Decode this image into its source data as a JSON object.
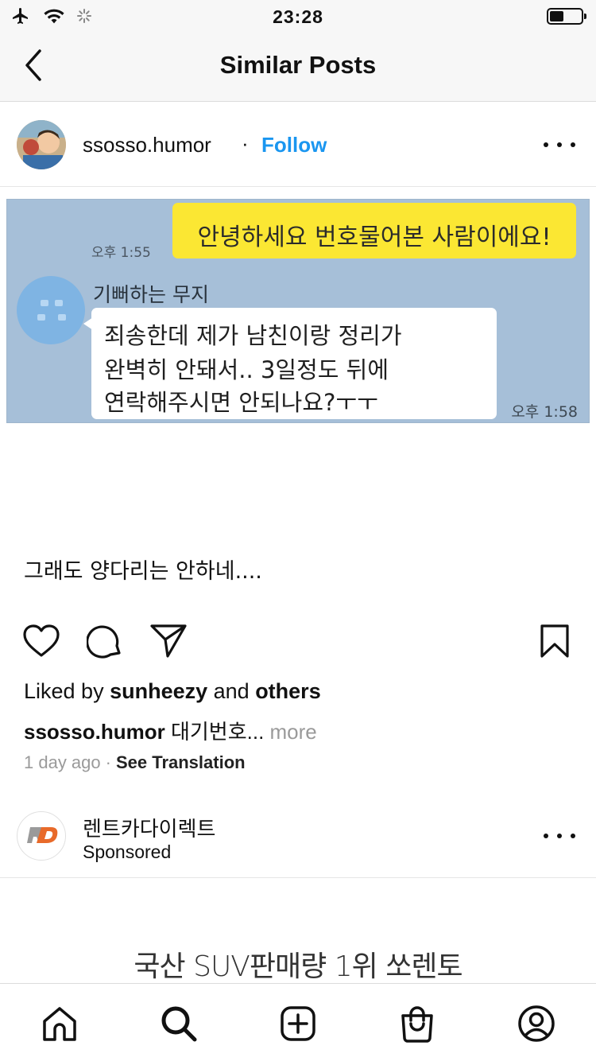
{
  "status_bar": {
    "time": "23:28",
    "icons": [
      "airplane-icon",
      "wifi-icon",
      "activity-spinner-icon",
      "battery-icon"
    ]
  },
  "nav": {
    "title": "Similar Posts",
    "back_icon": "chevron-left-icon"
  },
  "post": {
    "username": "ssosso.humor",
    "separator": "·",
    "follow_label": "Follow",
    "accent_color": "#1a96f0",
    "image": {
      "sent_message": "안녕하세요 번호물어본 사람이에요!",
      "sent_time": "오후 1:55",
      "sender_name": "기뻐하는 무지",
      "reply_lines": [
        "죄송한데 제가 남친이랑 정리가",
        "완벽히 안돼서.. 3일정도 뒤에",
        "연락해주시면 안되나요?ㅜㅜ"
      ],
      "reply_time": "오후 1:58"
    },
    "text": "그래도 양다리는 안하네....",
    "likes": {
      "prefix": "Liked by ",
      "user": "sunheezy",
      "mid": " and ",
      "others": "others"
    },
    "caption": {
      "user": "ssosso.humor",
      "text": " 대기번호...",
      "more": " more"
    },
    "meta": {
      "time_ago": "1 day ago",
      "separator": "·",
      "translate": "See Translation"
    }
  },
  "sponsored": {
    "name": "렌트카다이렉트",
    "label": "Sponsored",
    "ad_text": "국산 SUV판매량 1위 쏘렌토"
  },
  "tabs": [
    "home-icon",
    "search-icon",
    "new-post-icon",
    "shop-icon",
    "profile-icon"
  ]
}
